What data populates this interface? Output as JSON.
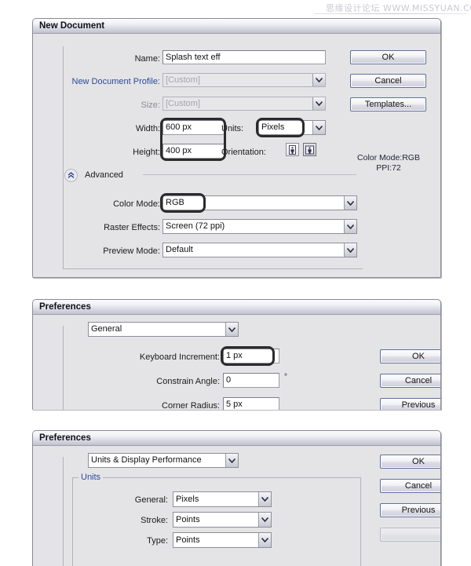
{
  "watermark": {
    "text": "思缘设计论坛  WWW.MISSYUAN.COM"
  },
  "new_document": {
    "title": "New Document",
    "fields": {
      "name_label": "Name:",
      "name_value": "Splash text eff",
      "profile_label": "New Document Profile:",
      "profile_value": "[Custom]",
      "size_label": "Size:",
      "size_value": "[Custom]",
      "width_label": "Width:",
      "width_value": "600 px",
      "height_label": "Height:",
      "height_value": "400 px",
      "units_label": "Units:",
      "units_value": "Pixels",
      "orientation_label": "Orientation:",
      "advanced_label": "Advanced",
      "color_mode_label": "Color Mode:",
      "color_mode_value": "RGB",
      "raster_effects_label": "Raster Effects:",
      "raster_effects_value": "Screen (72 ppi)",
      "preview_mode_label": "Preview Mode:",
      "preview_mode_value": "Default"
    },
    "buttons": {
      "ok": "OK",
      "cancel": "Cancel",
      "templates": "Templates..."
    },
    "info": {
      "color_mode": "Color Mode:RGB",
      "ppi": "PPI:72"
    }
  },
  "preferences_general": {
    "title": "Preferences",
    "section_value": "General",
    "fields": {
      "keyboard_increment_label": "Keyboard Increment:",
      "keyboard_increment_value": "1 px",
      "constrain_angle_label": "Constrain Angle:",
      "constrain_angle_value": "0",
      "degree_symbol": "°",
      "corner_radius_label": "Corner Radius:",
      "corner_radius_value": "5 px"
    },
    "buttons": {
      "ok": "OK",
      "cancel": "Cancel",
      "previous": "Previous"
    }
  },
  "preferences_units": {
    "title": "Preferences",
    "section_value": "Units & Display Performance",
    "group_legend": "Units",
    "fields": {
      "general_label": "General:",
      "general_value": "Pixels",
      "stroke_label": "Stroke:",
      "stroke_value": "Points",
      "type_label": "Type:",
      "type_value": "Points"
    },
    "buttons": {
      "ok": "OK",
      "cancel": "Cancel",
      "previous": "Previous",
      "next": ""
    }
  },
  "colors": {
    "dialog_bg": "#e4e4e6",
    "legend_blue": "#2b4a9b",
    "highlight_ring": "#2b2b2b",
    "button_border": "#5f6f95"
  }
}
